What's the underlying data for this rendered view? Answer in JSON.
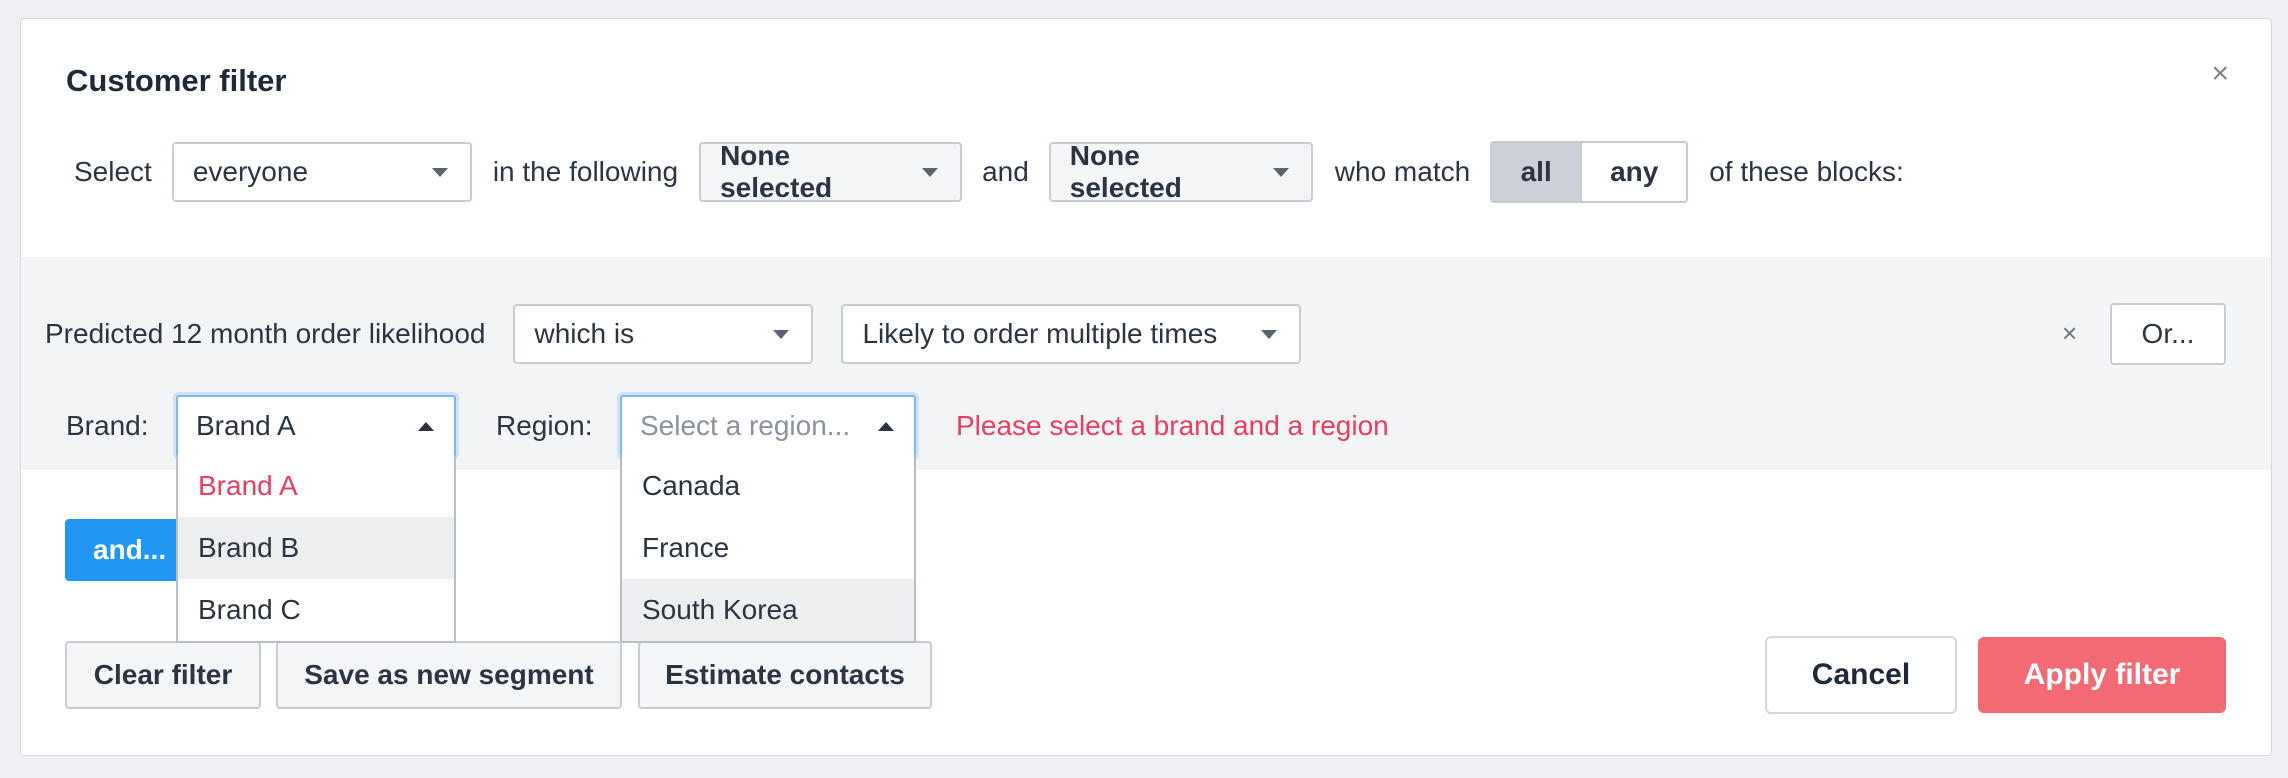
{
  "dialog": {
    "title": "Customer filter",
    "close_glyph": "×"
  },
  "selector": {
    "select_word": "Select",
    "audience_value": "everyone",
    "in_following_word": "in the following",
    "first_list_value": "None selected",
    "and_word": "and",
    "second_list_value": "None selected",
    "who_match_word": "who match",
    "match_options": [
      "all",
      "any"
    ],
    "match_selected": "all",
    "tail_text": "of these blocks:"
  },
  "block": {
    "field_label": "Predicted 12 month order likelihood",
    "operator_value": "which is",
    "value_value": "Likely to order multiple times",
    "remove_glyph": "×",
    "or_label": "Or...",
    "brand_label": "Brand:",
    "brand_value": "Brand A",
    "brand_options": [
      "Brand A",
      "Brand B",
      "Brand C"
    ],
    "region_label": "Region:",
    "region_placeholder": "Select a region...",
    "region_options": [
      "Canada",
      "France",
      "South Korea"
    ],
    "error_message": "Please select a brand and a region"
  },
  "actions": {
    "and_label": "and...",
    "clear_label": "Clear filter",
    "save_segment_label": "Save as new segment",
    "estimate_label": "Estimate contacts",
    "cancel_label": "Cancel",
    "apply_label": "Apply filter"
  },
  "colors": {
    "primary_blue": "#2196f3",
    "apply_red": "#f26b74",
    "error_red": "#e63f5f",
    "block_bg": "#f3f4f6"
  }
}
